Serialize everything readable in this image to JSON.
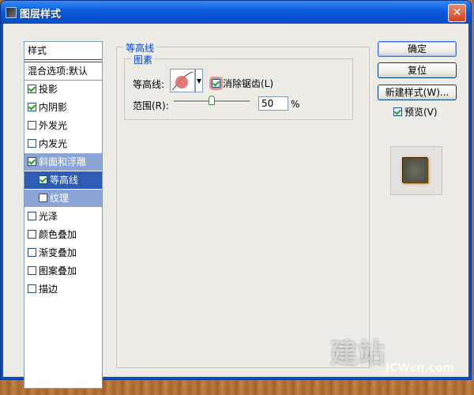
{
  "window": {
    "title": "图层样式",
    "close_symbol": "✕"
  },
  "styles_panel": {
    "header": "样式",
    "blend_options": "混合选项:默认",
    "items": [
      {
        "label": "投影",
        "checked": true
      },
      {
        "label": "内阴影",
        "checked": true
      },
      {
        "label": "外发光",
        "checked": false
      },
      {
        "label": "内发光",
        "checked": false
      },
      {
        "label": "斜面和浮雕",
        "checked": true
      },
      {
        "label": "等高线",
        "checked": true
      },
      {
        "label": "纹理",
        "checked": false
      },
      {
        "label": "光泽",
        "checked": false
      },
      {
        "label": "颜色叠加",
        "checked": false
      },
      {
        "label": "渐变叠加",
        "checked": false
      },
      {
        "label": "图案叠加",
        "checked": false
      },
      {
        "label": "描边",
        "checked": false
      }
    ]
  },
  "main": {
    "section_title": "等高线",
    "group_title": "图素",
    "contour_label": "等高线:",
    "antialias_label": "消除锯齿(L)",
    "antialias_checked": true,
    "range_label": "范围(R):",
    "range_value": "50",
    "range_unit": "%",
    "range_fraction": 0.5
  },
  "buttons": {
    "ok": "确定",
    "reset": "复位",
    "new_style": "新建样式(W)...",
    "preview_label": "预览(V)",
    "preview_checked": true
  },
  "watermark": {
    "big": "建站",
    "small": "JCWcn.com"
  }
}
